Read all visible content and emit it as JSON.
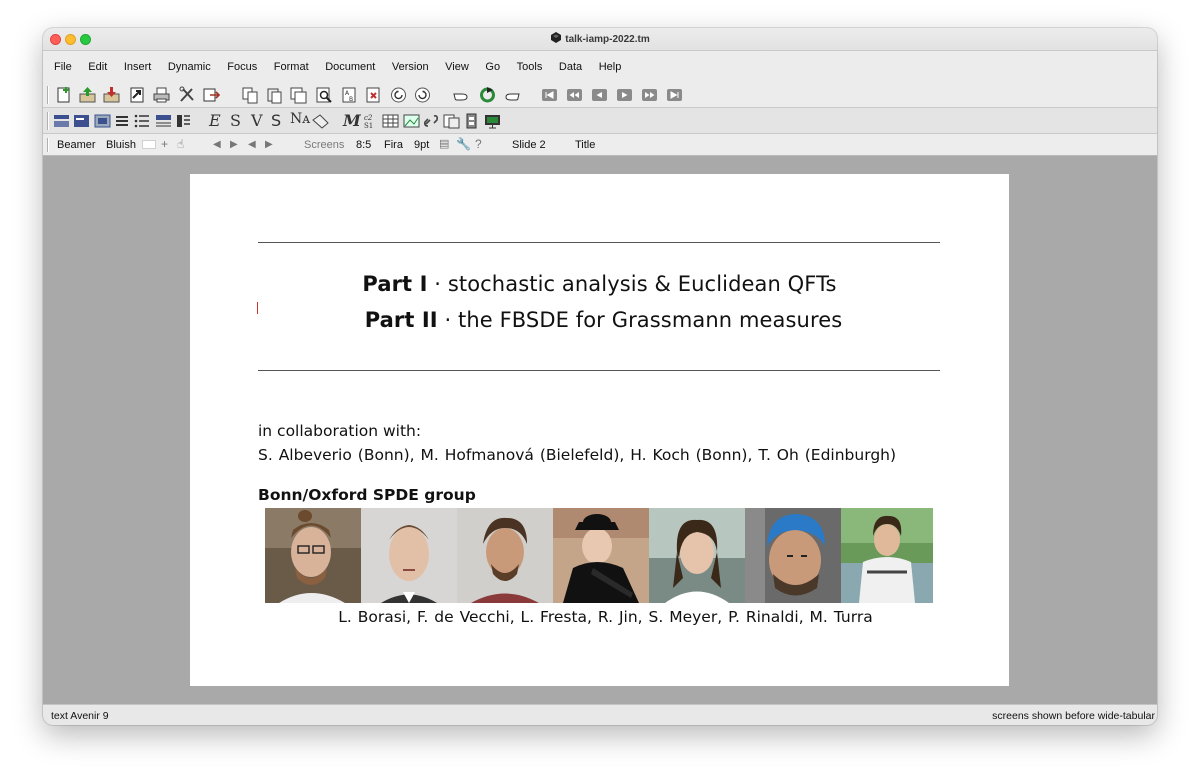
{
  "window": {
    "title": "talk-iamp-2022.tm"
  },
  "menu": [
    "File",
    "Edit",
    "Insert",
    "Dynamic",
    "Focus",
    "Format",
    "Document",
    "Version",
    "View",
    "Go",
    "Tools",
    "Data",
    "Help"
  ],
  "toolbar_main": [
    "new-document-icon",
    "open-document-icon",
    "save-document-icon",
    "export-icon",
    "print-icon",
    "preferences-icon",
    "share-icon",
    "copy-icon",
    "paste-icon",
    "duplicate-icon",
    "find-icon",
    "replace-icon",
    "spell-check-icon",
    "undo-icon",
    "redo-icon",
    "back-hand-icon",
    "refresh-icon",
    "forward-hand-icon",
    "first-slide-icon",
    "previous-screen-icon",
    "previous-slide-icon",
    "next-slide-icon",
    "next-screen-icon",
    "last-slide-icon"
  ],
  "toolbar_format": {
    "letters": [
      "E",
      "S",
      "V",
      "S",
      "Nᴀ"
    ],
    "insert_letters": [
      "M"
    ]
  },
  "focusbar": {
    "style": "Beamer",
    "theme": "Bluish",
    "screens_label": "Screens",
    "ratio": "8:5",
    "font": "Fira",
    "size": "9pt",
    "slide": "Slide 2",
    "tag": "Title"
  },
  "slide": {
    "part1_bold": "Part I",
    "part1_rest": " · stochastic analysis & Euclidean QFTs",
    "part2_bold": "Part II",
    "part2_rest": " · the FBSDE for Grassmann measures",
    "collab_intro": "in collaboration with:",
    "collaborators": "S. Albeverio (Bonn), M. Hofmanová (Bielefeld), H. Koch (Bonn), T. Oh (Edinburgh)",
    "group_title": "Bonn/Oxford SPDE group",
    "members": "L. Borasi, F. de Vecchi, L. Fresta, R. Jin, S. Meyer, P. Rinaldi, M. Turra",
    "photos": [
      {
        "name": "portrait-photo-1"
      },
      {
        "name": "portrait-photo-2"
      },
      {
        "name": "portrait-photo-3"
      },
      {
        "name": "portrait-photo-4"
      },
      {
        "name": "portrait-photo-5"
      },
      {
        "name": "portrait-photo-6"
      },
      {
        "name": "portrait-photo-7"
      }
    ]
  },
  "status": {
    "left": "text Avenir 9",
    "right": "screens shown before wide-tabular"
  },
  "colors": {
    "canvas_bg": "#a9a9a9",
    "slide_bg": "#ffffff",
    "rule": "#555555"
  }
}
